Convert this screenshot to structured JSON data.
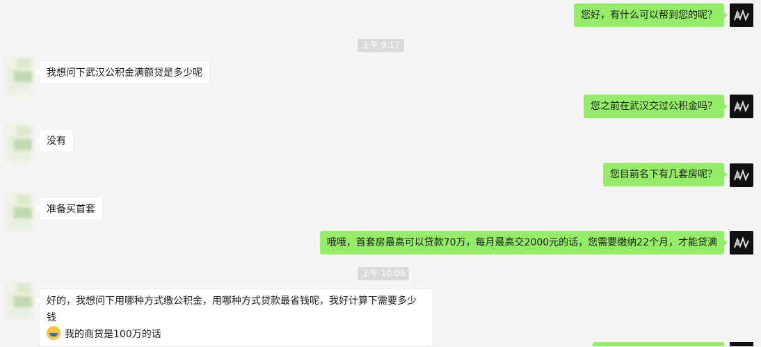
{
  "messages": {
    "m1": "您好，有什么可以帮到您的呢？",
    "m2": "我想问下武汉公积金满额贷是多少呢",
    "m3": "您之前在武汉交过公积金吗？",
    "m4": "没有",
    "m5": "您目前名下有几套房呢？",
    "m6": "准备买首套",
    "m7": "哦哦，首套房最高可以贷款70万，每月最高交2000元的话，您需要缴纳22个月，才能贷满",
    "m8_line1": "好的，我想问下用哪种方式缴公积金，用哪种方式贷款最省钱呢，我好计算下需要多少钱",
    "m8_line2": "我的商贷是100万的话"
  },
  "timestamps": {
    "t1": "上午 9:17",
    "t2": "上午 10:06"
  },
  "icons": {
    "agent_avatar": "avatar-icon",
    "customer_avatar": "blurred-avatar-icon",
    "emoji": "tears-of-joy-emoji-icon"
  },
  "colors": {
    "sent_bubble": "#95ec69",
    "received_bubble": "#ffffff",
    "background": "#f5f5f5"
  }
}
